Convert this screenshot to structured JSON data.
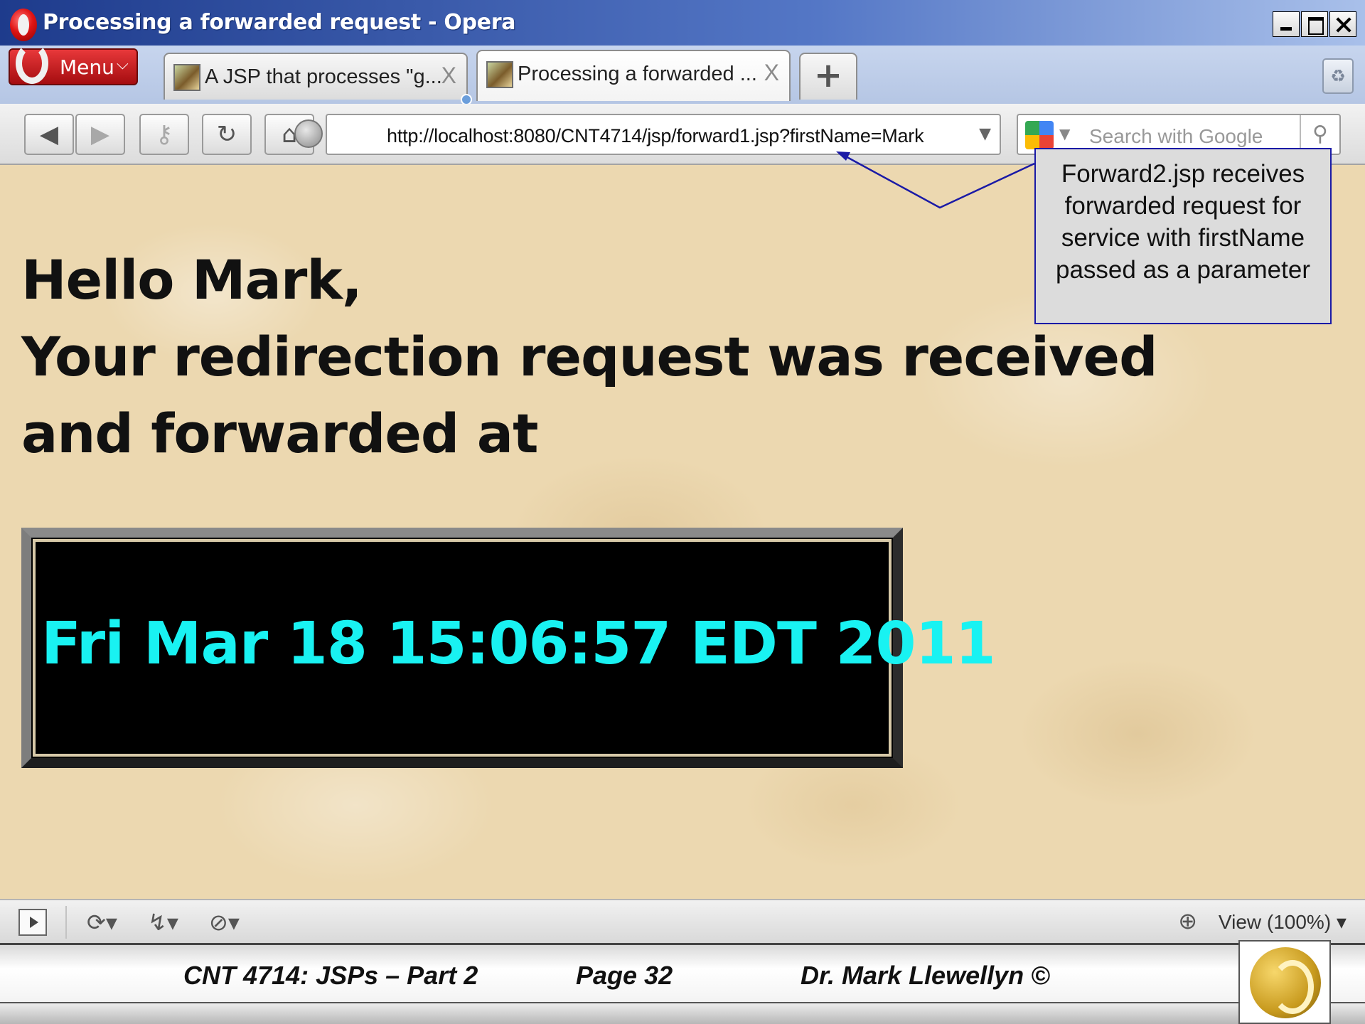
{
  "window": {
    "title": "Processing a forwarded request - Opera"
  },
  "tabbar": {
    "menu_label": "Menu",
    "tabs": [
      {
        "label": "A JSP that processes \"g...",
        "active": false
      },
      {
        "label": "Processing a forwarded ...",
        "active": true
      }
    ],
    "close_glyph": "X",
    "new_tab_glyph": "+"
  },
  "addressbar": {
    "url": "http://localhost:8080/CNT4714/jsp/forward1.jsp?firstName=Mark",
    "search_placeholder": "Search with Google"
  },
  "page": {
    "greeting_line1": "Hello Mark,",
    "greeting_line2": "Your redirection request was received",
    "greeting_line3": "and forwarded at",
    "timestamp": "Fri Mar 18 15:06:57 EDT 2011",
    "timestamp_color": "#19f2f2",
    "background_color": "#ecd8b0"
  },
  "callout": {
    "text": "Forward2.jsp receives forwarded request for service with firstName passed as a parameter",
    "border_color": "#1a1aa6"
  },
  "statusbar": {
    "zoom_label": "View (100%)"
  },
  "footer": {
    "course": "CNT 4714: JSPs – Part 2",
    "page": "Page 32",
    "author": "Dr. Mark Llewellyn ©"
  },
  "icons": {
    "back": "back-arrow-icon",
    "forward": "forward-arrow-icon",
    "key": "key-icon",
    "reload": "reload-icon",
    "home": "home-icon",
    "globe": "globe-icon",
    "search": "search-icon",
    "zoom": "zoom-icon"
  }
}
